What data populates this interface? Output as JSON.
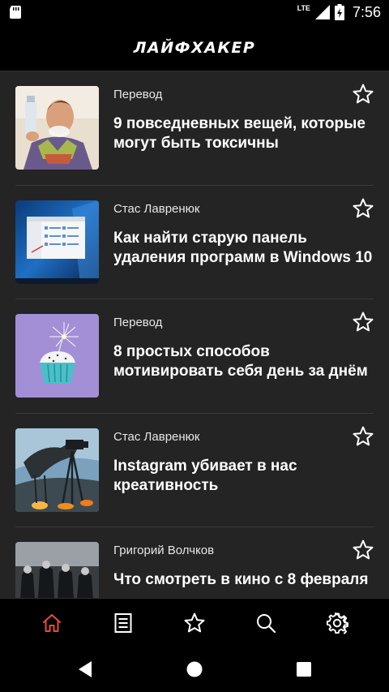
{
  "status_bar": {
    "network": "LTE",
    "time": "7:56"
  },
  "app": {
    "title": "ЛАЙФХАКЕР"
  },
  "articles": [
    {
      "author": "Перевод",
      "title": "9 повседневных вещей, которые могут быть токсичны",
      "image": "man-with-air-freshener"
    },
    {
      "author": "Стас Лавренюк",
      "title": "Как найти старую панель удаления программ в Windows 10",
      "image": "windows-10-screenshot"
    },
    {
      "author": "Перевод",
      "title": "8 простых способов мотивировать себя день за днём",
      "image": "cupcake-with-sparkler"
    },
    {
      "author": "Стас Лавренюк",
      "title": "Instagram убивает в нас креативность",
      "image": "photographer-with-tripod"
    },
    {
      "author": "Григорий Волчков",
      "title": "Что смотреть в кино с 8 февраля",
      "image": "movie-poster"
    }
  ],
  "tabs": [
    {
      "name": "home",
      "icon": "home-icon",
      "active": true
    },
    {
      "name": "categories",
      "icon": "list-icon",
      "active": false
    },
    {
      "name": "favorites",
      "icon": "star-icon",
      "active": false
    },
    {
      "name": "search",
      "icon": "search-icon",
      "active": false
    },
    {
      "name": "settings",
      "icon": "gear-icon",
      "active": false
    }
  ],
  "colors": {
    "background": "#000000",
    "feed_background": "#242424",
    "accent": "#e0503c",
    "text": "#ffffff"
  }
}
